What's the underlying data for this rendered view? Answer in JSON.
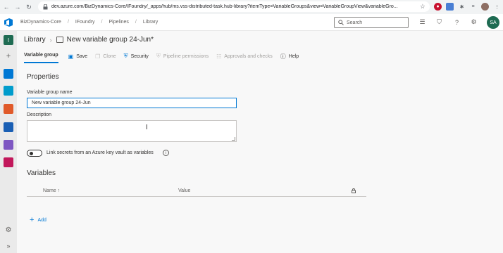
{
  "browser": {
    "url": "dev.azure.com/BizDynamics-Core/IFoundry/_apps/hub/ms.vss-distributed-task.hub-library?itemType=VariableGroups&view=VariableGroupView&variableGro..."
  },
  "topbar": {
    "breadcrumb": [
      "BizDynamics-Core",
      "IFoundry",
      "Pipelines",
      "Library"
    ],
    "search_placeholder": "Search",
    "avatar_initials": "SA"
  },
  "page": {
    "library": "Library",
    "title": "New variable group 24-Jun*"
  },
  "commands": {
    "tab": "Variable group",
    "save": "Save",
    "clone": "Clone",
    "security": "Security",
    "pipeline_permissions": "Pipeline permissions",
    "approvals": "Approvals and checks",
    "help": "Help"
  },
  "properties": {
    "heading": "Properties",
    "name_label": "Variable group name",
    "name_value": "New variable group 24-Jun",
    "description_label": "Description",
    "description_value": "",
    "keyvault_label": "Link secrets from an Azure key vault as variables",
    "keyvault_enabled": false
  },
  "variables": {
    "heading": "Variables",
    "col_name": "Name",
    "col_name_sort": "↑",
    "col_value": "Value",
    "add": "Add"
  },
  "colors": {
    "accent": "#0078d4",
    "avatar": "#1e6b52"
  }
}
